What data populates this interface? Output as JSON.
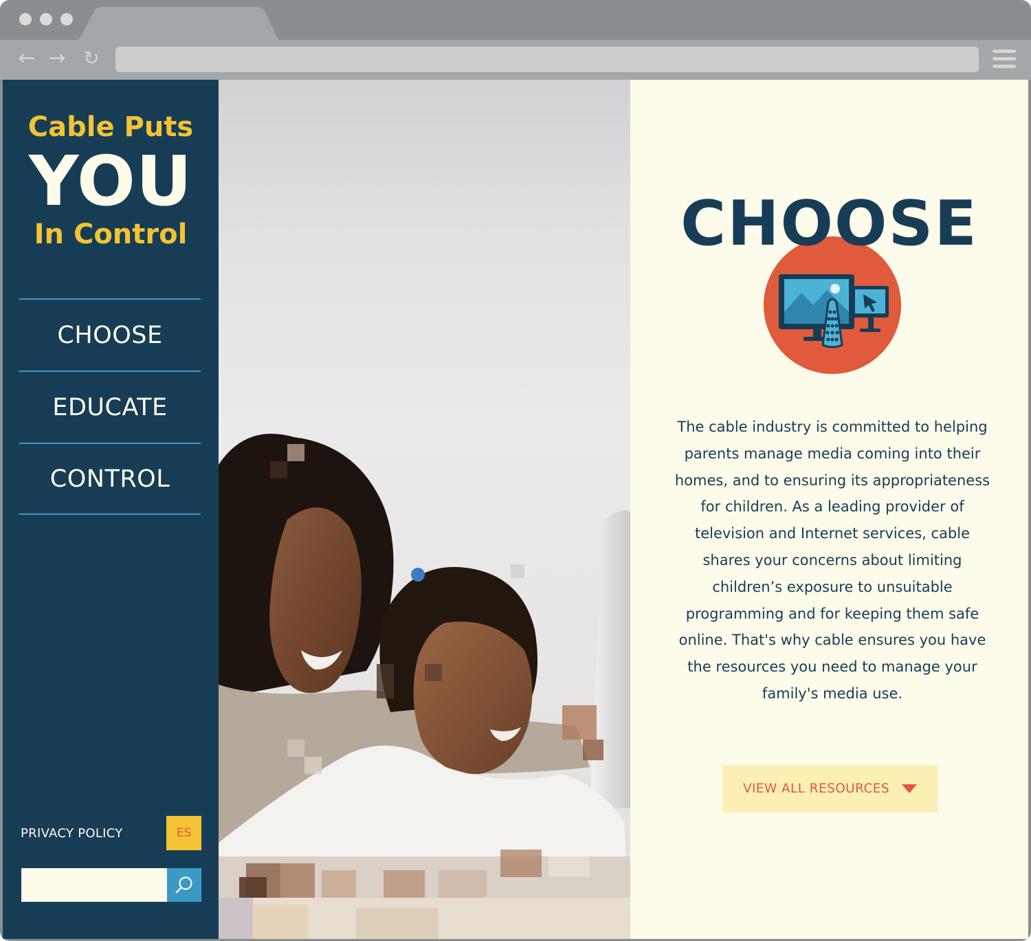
{
  "sidebar": {
    "logo": {
      "line1": "Cable Puts",
      "line2": "YOU",
      "line3": "In Control"
    },
    "nav": [
      {
        "label": "CHOOSE"
      },
      {
        "label": "EDUCATE"
      },
      {
        "label": "CONTROL"
      }
    ],
    "privacy_label": "PRIVACY POLICY",
    "language_label": "ES",
    "search": {
      "placeholder": "",
      "value": ""
    }
  },
  "main": {
    "heading": "CHOOSE",
    "body": "The cable industry is committed to helping parents manage media coming into their homes, and to ensuring its appropriateness for children. As a leading provider of television and Internet services, cable shares your concerns about limiting children’s exposure to unsuitable programming and for keeping them safe online. That's why cable ensures you have the resources you need to manage your family's media use.",
    "cta_label": "VIEW ALL RESOURCES"
  },
  "colors": {
    "sidebar_bg": "#173d56",
    "accent_yellow": "#f3c333",
    "accent_blue": "#3a9ac6",
    "accent_orange": "#e05a3c",
    "cream": "#fdfbe9",
    "cta_bg": "#fcefb4"
  },
  "icons": {
    "section_icon": "devices-remote-icon",
    "search_icon": "search-icon",
    "cta_icon": "caret-down-icon"
  }
}
